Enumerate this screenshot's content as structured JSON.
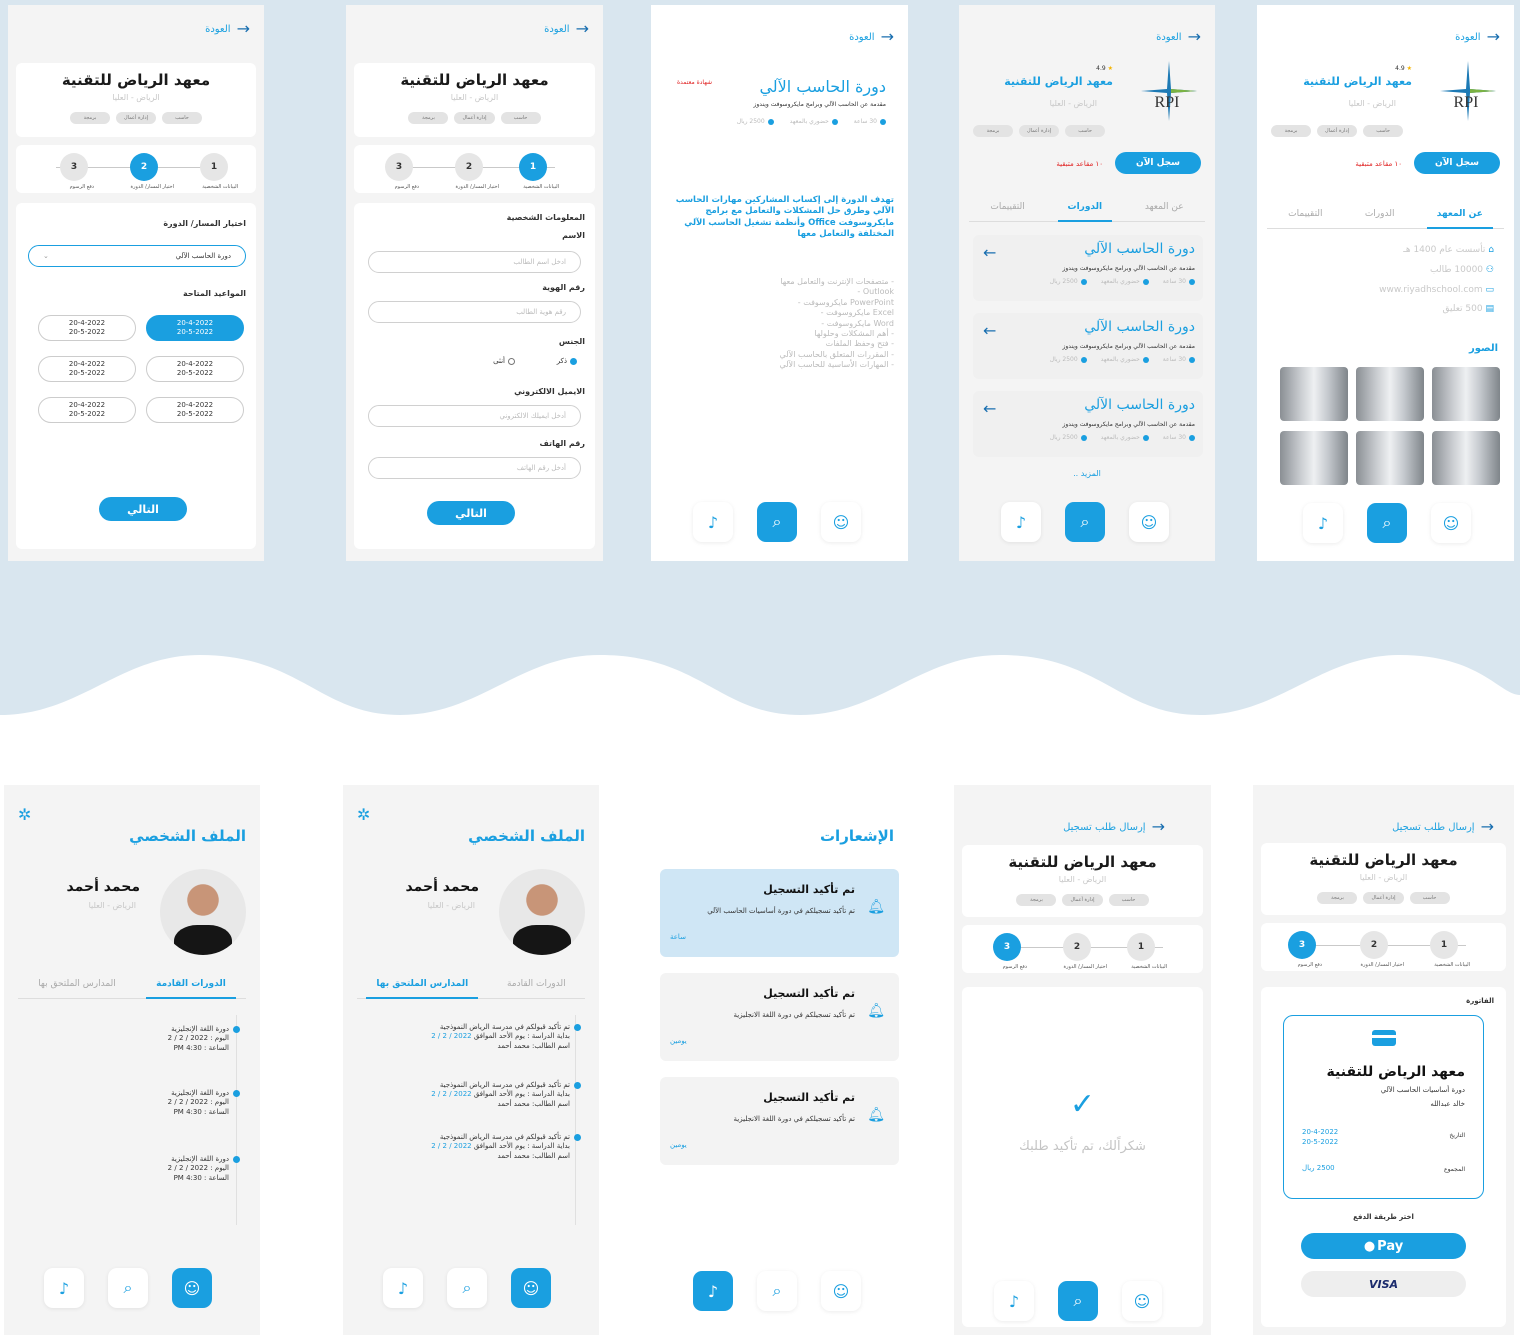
{
  "common": {
    "back": "العودة",
    "school": "معهد الرياض للتقنية",
    "location": "الرياض - العليا",
    "chips": [
      "حاسب",
      "إدارة أعمال",
      "برمجة"
    ],
    "rating": "4.9",
    "steps": [
      "البيانات الشخصية",
      "اختيار المسار/ الدورة",
      "دفع الرسوم"
    ],
    "next": "التالي",
    "logo": "RPI"
  },
  "s1": {
    "track_label": "اختيار المسار/ الدورة",
    "track_value": "دورة الحاسب الآلي",
    "dates_label": "المواعيد المتاحة",
    "dates": [
      [
        "20-4-2022",
        "20-5-2022"
      ],
      [
        "20-4-2022",
        "20-5-2022"
      ],
      [
        "20-4-2022",
        "20-5-2022"
      ],
      [
        "20-4-2022",
        "20-5-2022"
      ],
      [
        "20-4-2022",
        "20-5-2022"
      ],
      [
        "20-4-2022",
        "20-5-2022"
      ]
    ]
  },
  "s2": {
    "section": "المعلومات الشخصية",
    "name_label": "الاسم",
    "name_ph": "ادخل اسم الطالب",
    "id_label": "رقم الهوية",
    "id_ph": "رقم هوية الطالب",
    "gender_label": "الجنس",
    "male": "ذكر",
    "female": "أنثى",
    "email_label": "الايميل الالكتروني",
    "email_ph": "أدخل ايميلك الالكتروني",
    "phone_label": "رقم الهاتف",
    "phone_ph": "أدخل رقم الهاتف"
  },
  "s3": {
    "badge": "شهادة معتمدة",
    "title": "دورة الحاسب الآلي",
    "desc": "مقدمة عن الحاسب الآلي وبرامج مايكروسوفت ويندوز",
    "meta": [
      "30 ساعة",
      "حضوري بالمعهد",
      "2500 ريال"
    ],
    "goal": "تهدف الدورة إلى إكساب المشاركين مهارات الحاسب الآلي وطرق حل المشكلات والتعامل مع برامج مايكروسوفت Office وأنظمة تشغيل الحاسب الآلي المختلفة والتعامل معها",
    "items": [
      "- متصفحات الإنترنت والتعامل معها",
      "Outlook -",
      "PowerPoint مايكروسوفت -",
      "Excel مايكروسوفت -",
      "Word مايكروسوفت -",
      "- أهم المشكلات وحلولها",
      "- فتح وحفظ الملفات",
      "- المقررات المتعلق بالحاسب الآلي",
      "- المهارات الأساسية للحاسب الآلي"
    ]
  },
  "s4": {
    "register": "سجل الآن",
    "seats": "١٠ مقاعد متبقية",
    "tabs": [
      "عن المعهد",
      "الدورات",
      "التقييمات"
    ],
    "course_title": "دورة الحاسب الآلي",
    "course_desc": "مقدمة عن الحاسب الآلي وبرامج مايكروسوفت ويندوز",
    "meta": [
      "30 ساعة",
      "حضوري بالمعهد",
      "2500 ريال"
    ],
    "more": "المزيد .."
  },
  "s5": {
    "info": [
      "تأسست عام 1400 هـ",
      "10000 طالب",
      "www.riyadhschool.com",
      "500 تعليق"
    ],
    "photos": "الصور"
  },
  "p": {
    "title": "الملف الشخصي",
    "name": "محمد أحمد",
    "location": "الرياض - العليا",
    "tab_upcoming": "الدورات القادمة",
    "tab_schools": "المدارس الملتحق بها",
    "course": "دورة اللغة الإنجليزية",
    "day": "اليوم : 2022 / 2 / 2",
    "time": "الساعة : 4:30 PM",
    "acc1": "تم تأكيد قبولكم في مدرسة الرياض النموذجية",
    "acc2": "بداية الدراسة : يوم الأحد الموافق",
    "acc_date": "2022 / 2 / 2",
    "acc3": "اسم الطالب: محمد أحمد"
  },
  "n": {
    "title": "الإشعارات",
    "items": [
      {
        "t": "تم تأكيد التسجيل",
        "d": "تم تأكيد تسجيلكم في دورة أساسيات الحاسب الآلي",
        "w": "ساعة"
      },
      {
        "t": "تم تأكيد التسجيل",
        "d": "تم تأكيد تسجيلكم في دورة اللغة الانجليزية",
        "w": "يومين"
      },
      {
        "t": "تم تأكيد التسجيل",
        "d": "تم تأكيد تسجيلكم في دورة اللغة الانجليزية",
        "w": "يومين"
      }
    ]
  },
  "c": {
    "back": "إرسال طلب تسجيل",
    "thanks": "شكراًلك، تم تأكيد طلبك",
    "invoice": "الفاتورة",
    "course": "دورة أساسيات الحاسب الآلي",
    "student": "خالد عبدالله",
    "date_label": "التاريخ",
    "date1": "20-4-2022",
    "date2": "20-5-2022",
    "total_label": "المجموع",
    "total": "2500 ريال",
    "pay_label": "اختر طريقة الدفع",
    "apple": "Pay",
    "visa": "VISA"
  }
}
